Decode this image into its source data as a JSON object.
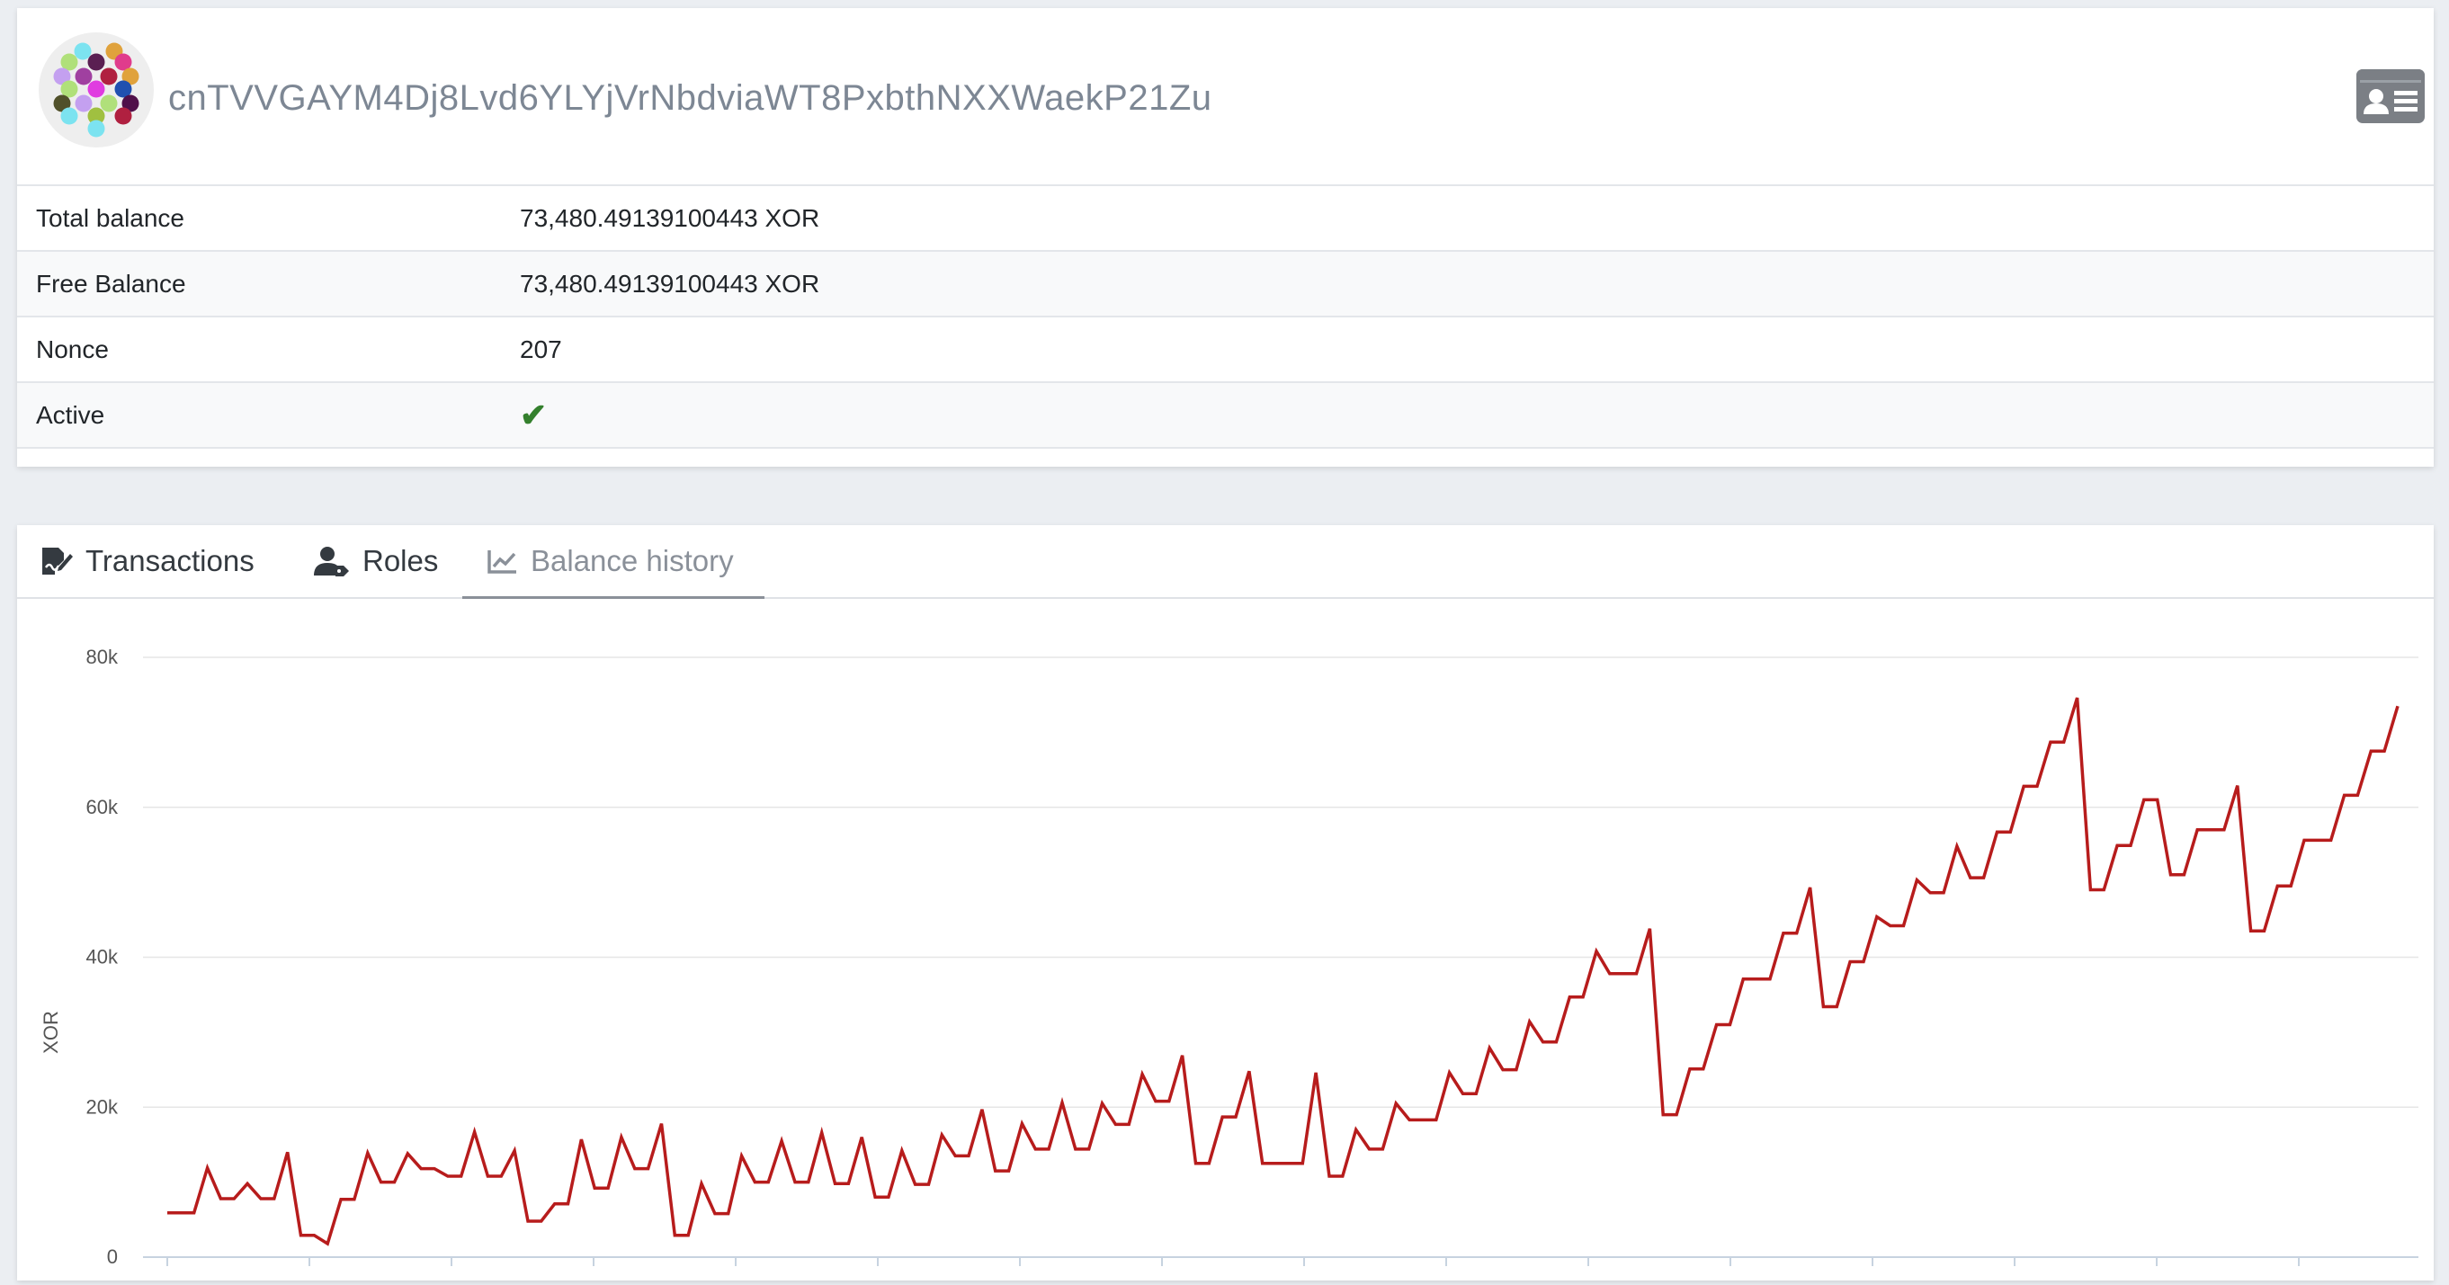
{
  "account": {
    "address": "cnTVVGAYM4Dj8Lvd6YLYjVrNbdviaWT8PxbthNXXWaekP21Zu",
    "rows": [
      {
        "label": "Total balance",
        "value": "73,480.49139100443 XOR"
      },
      {
        "label": "Free Balance",
        "value": "73,480.49139100443 XOR"
      },
      {
        "label": "Nonce",
        "value": "207"
      },
      {
        "label": "Active",
        "value": "✔"
      }
    ],
    "active_color": "#34802d",
    "icons": {
      "avatar": "identicon",
      "profile": "id-card-icon"
    }
  },
  "tabs": [
    {
      "label": "Transactions",
      "icon": "file-signature-icon",
      "active": false
    },
    {
      "label": "Roles",
      "icon": "user-tag-icon",
      "active": false
    },
    {
      "label": "Balance history",
      "icon": "chart-line-icon",
      "active": true
    }
  ],
  "chart_data": {
    "type": "line",
    "title": "",
    "xlabel": "",
    "ylabel": "XOR",
    "ylim": [
      0,
      80000
    ],
    "yticks": [
      "0",
      "20k",
      "40k",
      "60k",
      "80k"
    ],
    "yticks_values": [
      0,
      20000,
      40000,
      60000,
      80000
    ],
    "grid": true,
    "series_color": "#b71c1c",
    "series": [
      {
        "values": [
          5900,
          5900,
          5900,
          11900,
          7800,
          7800,
          9800,
          7800,
          7800,
          14000,
          2900,
          2900,
          1800,
          7700,
          7700,
          13900,
          10000,
          10000,
          13800,
          11800,
          11800,
          10800,
          10800,
          16700,
          10800,
          10800,
          14200,
          4800,
          4800,
          7100,
          7100,
          15700,
          9200,
          9200,
          16000,
          11800,
          11800,
          17800,
          2900,
          2900,
          9800,
          5800,
          5800,
          13500,
          10000,
          10000,
          15500,
          10000,
          10000,
          16600,
          9800,
          9800,
          16000,
          8000,
          8000,
          14200,
          9700,
          9700,
          16300,
          13500,
          13500,
          19700,
          11500,
          11500,
          17800,
          14400,
          14400,
          20600,
          14400,
          14400,
          20500,
          17700,
          17700,
          24400,
          20800,
          20800,
          26900,
          12500,
          12500,
          18700,
          18700,
          24800,
          12500,
          12500,
          12500,
          12500,
          24600,
          10800,
          10800,
          17000,
          14400,
          14400,
          20500,
          18300,
          18300,
          18300,
          24600,
          21800,
          21800,
          27900,
          25000,
          25000,
          31400,
          28700,
          28700,
          34700,
          34700,
          40800,
          37800,
          37800,
          37800,
          43800,
          19000,
          19000,
          25100,
          25100,
          31000,
          31000,
          37100,
          37100,
          37100,
          43200,
          43200,
          49300,
          33400,
          33400,
          39400,
          39400,
          45400,
          44200,
          44200,
          50300,
          48600,
          48600,
          54800,
          50600,
          50600,
          56700,
          56700,
          62800,
          62800,
          68700,
          68700,
          74600,
          49000,
          49000,
          54900,
          54900,
          61000,
          61000,
          51000,
          51000,
          57000,
          57000,
          57000,
          62900,
          43500,
          43500,
          49500,
          49500,
          55600,
          55600,
          55600,
          61600,
          61600,
          67500,
          67500,
          73500
        ]
      }
    ]
  }
}
